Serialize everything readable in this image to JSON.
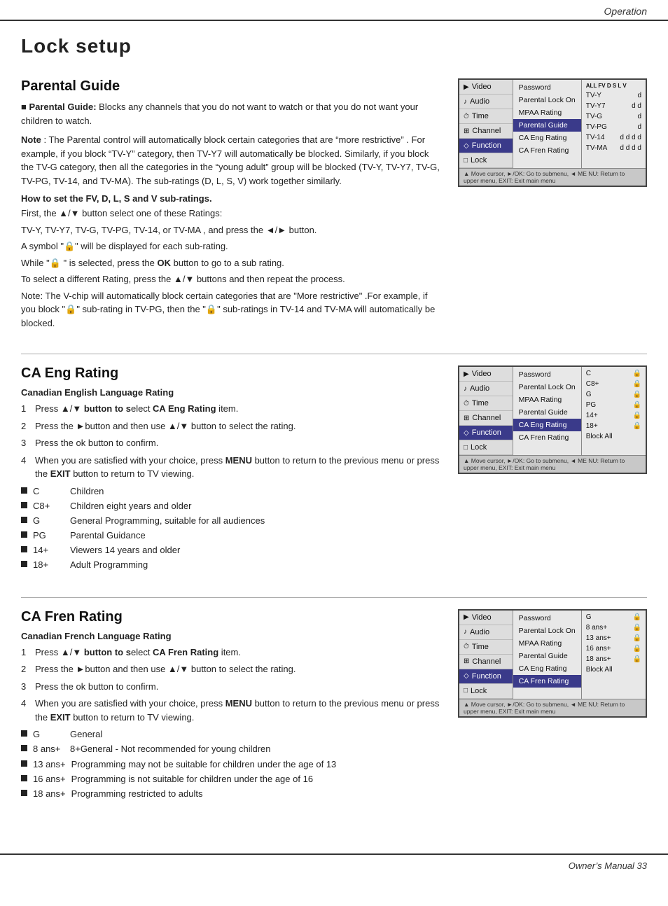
{
  "header": {
    "title": "Operation"
  },
  "page_title": "Lock setup",
  "sections": [
    {
      "id": "parental-guide",
      "heading": "Parental Guide",
      "intro_bold": "Parental Guide:",
      "intro_text": " Blocks any channels that you do not want to watch or that you do not want your children to watch.",
      "note_label": "Note",
      "note_text": " : The Parental control will automatically block certain categories that are “more restrictive” . For example, if you block “TV-Y”  category, then TV-Y7 will automatically be blocked. Similarly, if you block the TV-G category, then all the categories in the “young adult”  group will be blocked (TV-Y, TV-Y7, TV-G, TV-PG, TV-14, and TV-MA). The sub-ratings (D, L, S, V) work together similarly.",
      "sub_heading": "How to set the FV, D, L, S and V sub-ratings.",
      "sub_text": [
        "First, the ▲/▼ button select one of these Ratings:",
        "TV-Y, TV-Y7, TV-G, TV-PG, TV-14, or TV-MA , and press the ◄/► button.",
        "A symbol “🔒”  will be displayed for each sub-rating.",
        "While “🔒 ”  is selected, press the OK button to go to a sub rating.",
        " To select a different Rating, press the ▲/▼ buttons and then repeat the process.",
        "Note: The V-chip will automatically block certain categories that are “More restrictive”  .For example, if you block “🔒”  sub-rating in TV-PG, then the “🔒”  sub-ratings in TV-14 and TV-MA will automatically be blocked."
      ],
      "menu": {
        "left_items": [
          "Video",
          "Audio",
          "Time",
          "Channel",
          "Function",
          "Lock"
        ],
        "active_left": "Function",
        "center_items": [
          "Password",
          "Parental Lock  On",
          "MPAA Rating",
          "Parental Guide",
          "CA Eng Rating",
          "CA Fren Rating"
        ],
        "active_center": "Parental Guide",
        "right_header": "ALL FV D  S  L   V",
        "right_rows": [
          {
            "label": "TV-Y",
            "locks": "d"
          },
          {
            "label": "TV-Y7",
            "locks": "d  d️"
          },
          {
            "label": "TV-G",
            "locks": "d"
          },
          {
            "label": "TV-PG",
            "locks": "d"
          },
          {
            "label": "TV-14",
            "locks": "d   d d d d"
          },
          {
            "label": "TV-MA",
            "locks": "d   d d d d"
          }
        ],
        "footer": "▲ Move cursor, ►/OK: Go to submenu, ◄ ME NU: Return to upper menu, EXIT: Exit main menu"
      }
    },
    {
      "id": "ca-eng-rating",
      "heading": "CA Eng Rating",
      "sub_heading": "Canadian English Language Rating",
      "steps": [
        {
          "num": "1",
          "text": "Press ▲/▼ button to select CA Eng Rating item."
        },
        {
          "num": "2",
          "text": "Press the ► button and then use ▲/▼ button to select the rating."
        },
        {
          "num": "3",
          "text": "Press the ok button to confirm."
        },
        {
          "num": "4",
          "text": "When you are satisfied with your choice,  press MENU button to return to the previous menu or press the EXIT button to return to TV viewing."
        }
      ],
      "bullets": [
        {
          "label": "C",
          "desc": "Children"
        },
        {
          "label": "C8+",
          "desc": "Children eight years and older"
        },
        {
          "label": "G",
          "desc": "General Programming, suitable for all audiences"
        },
        {
          "label": "PG",
          "desc": "Parental Guidance"
        },
        {
          "label": "14+",
          "desc": "Viewers 14 years and older"
        },
        {
          "label": "18+",
          "desc": "Adult Programming"
        }
      ],
      "menu": {
        "left_items": [
          "Video",
          "Audio",
          "Time",
          "Channel",
          "Function",
          "Lock"
        ],
        "active_left": "Function",
        "center_items": [
          "Password",
          "Parental Lock  On",
          "MPAA Rating",
          "Parental Guide",
          "CA Eng Rating",
          "CA Fren Rating"
        ],
        "active_center": "CA Eng Rating",
        "right_rows": [
          {
            "label": "C",
            "has_lock": true
          },
          {
            "label": "C8+",
            "has_lock": true
          },
          {
            "label": "G",
            "has_lock": true
          },
          {
            "label": "PG",
            "has_lock": true
          },
          {
            "label": "14+",
            "has_lock": true
          },
          {
            "label": "18+",
            "has_lock": true
          },
          {
            "label": "Block All",
            "has_lock": false
          }
        ],
        "footer": "▲ Move cursor, ►/OK: Go to submenu, ◄ ME NU: Return to upper menu, EXIT: Exit main menu"
      }
    },
    {
      "id": "ca-fren-rating",
      "heading": "CA Fren Rating",
      "sub_heading": "Canadian French Language Rating",
      "steps": [
        {
          "num": "1",
          "text": "Press ▲/▼ button to select CA Fren Rating item."
        },
        {
          "num": "2",
          "text": "Press the ► button and then use ▲/▼ button to select the rating."
        },
        {
          "num": "3",
          "text": "Press the ok button to confirm."
        },
        {
          "num": "4",
          "text": "When you are satisfied with your choice,  press MENU button to return to the previous menu or press the EXIT button to return to TV viewing."
        }
      ],
      "bullets": [
        {
          "label": "G",
          "desc": "General"
        },
        {
          "label": "8 ans+",
          "desc": "8+General - Not recommended for young children"
        },
        {
          "label": "13 ans+",
          "desc": "Programming may not be suitable for children under the age of 13"
        },
        {
          "label": "16 ans+",
          "desc": "Programming is not suitable for children under the age of 16"
        },
        {
          "label": "18 ans+",
          "desc": "Programming restricted to adults"
        }
      ],
      "menu": {
        "left_items": [
          "Video",
          "Audio",
          "Time",
          "Channel",
          "Function",
          "Lock"
        ],
        "active_left": "Function",
        "center_items": [
          "Password",
          "Parental Lock  On",
          "MPAA Rating",
          "Parental Guide",
          "CA Eng Rating",
          "CA Fren Rating"
        ],
        "active_center": "CA Fren Rating",
        "right_rows": [
          {
            "label": "G",
            "has_lock": true
          },
          {
            "label": "8 ans+",
            "has_lock": true
          },
          {
            "label": "13 ans+",
            "has_lock": true
          },
          {
            "label": "16 ans+",
            "has_lock": true
          },
          {
            "label": "18 ans+",
            "has_lock": true
          },
          {
            "label": "Block All",
            "has_lock": false
          }
        ],
        "footer": "▲ Move cursor, ►/OK: Go to submenu, ◄ ME NU: Return to upper menu, EXIT: Exit main menu"
      }
    }
  ],
  "footer": {
    "text": "Owner’s Manual  33"
  },
  "menu_icons": {
    "Video": "▶",
    "Audio": "♪",
    "Time": "⏱",
    "Channel": "⊞",
    "Function": "◇",
    "Lock": "□"
  }
}
